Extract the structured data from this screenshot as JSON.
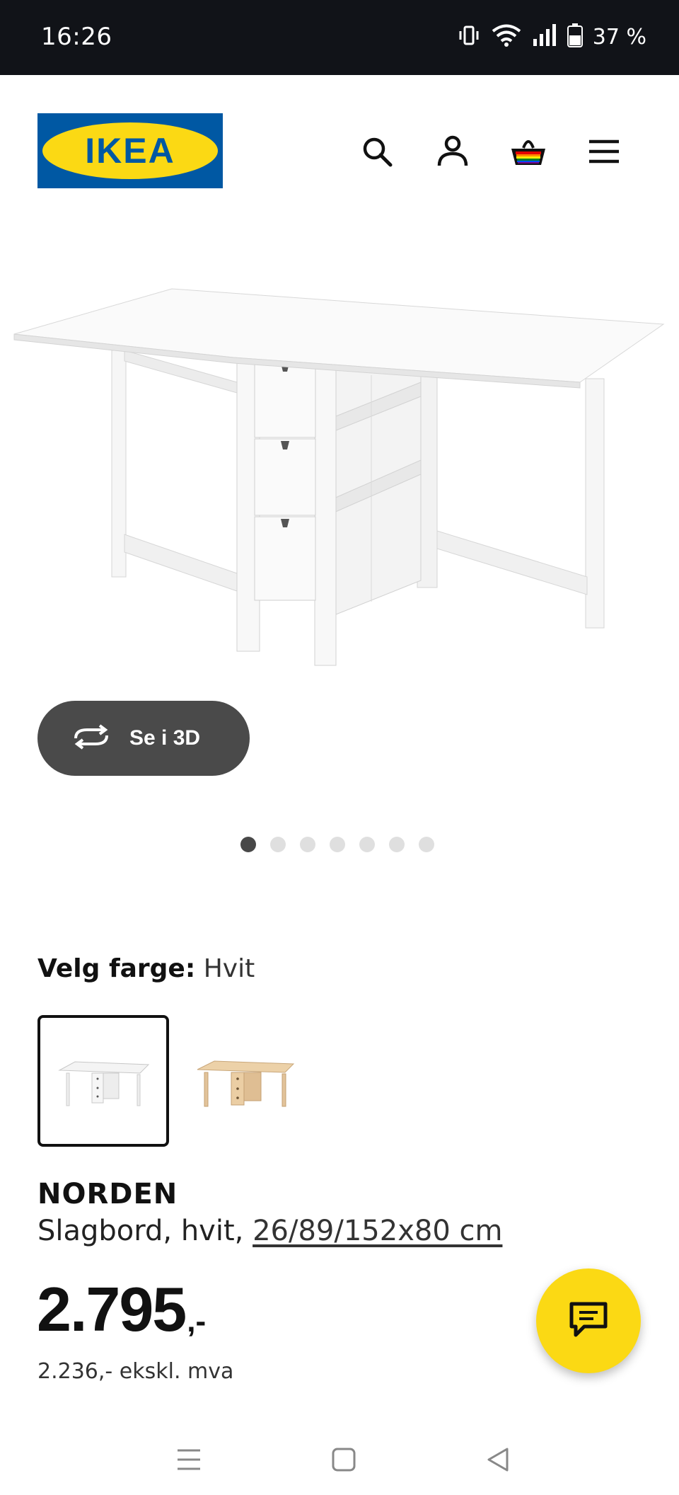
{
  "status_bar": {
    "time": "16:26",
    "battery_text": "37 %",
    "icons": [
      "vibrate-icon",
      "wifi-icon",
      "signal-icon",
      "battery-icon"
    ]
  },
  "header": {
    "logo_text": "IKEA",
    "icons": [
      "search-icon",
      "profile-icon",
      "basket-icon",
      "menu-icon"
    ],
    "brand_colors": {
      "blue": "#0058a3",
      "yellow": "#fbd914"
    }
  },
  "product_image": {
    "icon": "gateleg-table-image"
  },
  "view_3d": {
    "label": "Se i 3D",
    "icon": "rotate-3d-icon"
  },
  "carousel": {
    "total": 7,
    "active_index": 0
  },
  "color_select": {
    "label": "Velg farge:",
    "value": "Hvit",
    "options": [
      {
        "name": "white-table-swatch",
        "color": "#f4f4f4",
        "selected": true
      },
      {
        "name": "birch-table-swatch",
        "color": "#e7c9a0",
        "selected": false
      }
    ]
  },
  "product": {
    "name": "NORDEN",
    "description": "Slagbord, hvit, ",
    "dimensions": "26/89/152x80 cm",
    "price_main": "2.795",
    "price_suffix": ",-",
    "price_ex_vat": "2.236,- ekskl. mva"
  },
  "chat": {
    "icon": "chat-icon",
    "color": "#fbd914"
  },
  "nav_bar": {
    "icons": [
      "recent-apps-icon",
      "home-icon",
      "back-icon"
    ]
  }
}
